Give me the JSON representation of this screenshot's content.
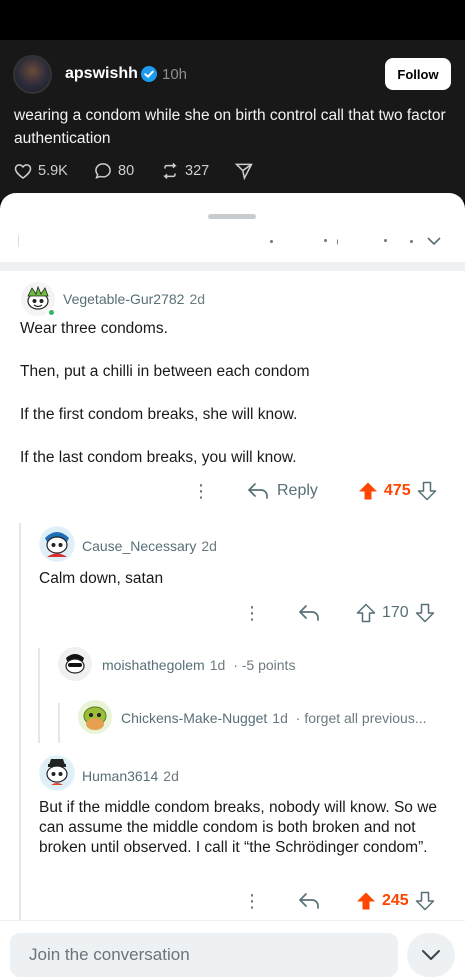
{
  "post": {
    "username": "apswishh",
    "time": "10h",
    "follow_label": "Follow",
    "text": "wearing a condom while she on birth control call that two factor authentication",
    "likes": "5.9K",
    "replies": "80",
    "reposts": "327"
  },
  "comments": [
    {
      "username": "Vegetable-Gur2782",
      "age": "2d",
      "paragraphs": [
        "Wear three condoms.",
        "Then, put a chilli in between each condom",
        "If the first condom breaks, she will know.",
        "If the last condom breaks, you will know."
      ],
      "reply_label": "Reply",
      "score": "475",
      "upvoted": true
    },
    {
      "username": "Cause_Necessary",
      "age": "2d",
      "text": "Calm down, satan",
      "score": "170",
      "upvoted": false
    },
    {
      "username": "moishathegolem",
      "age": "1d",
      "extra": "· -5 points"
    },
    {
      "username": "Chickens-Make-Nugget",
      "age": "1d",
      "extra": "· forget all previous..."
    },
    {
      "username": "Human3614",
      "age": "2d",
      "text": "But if the middle condom breaks, nobody will know. So we can assume the middle condom is both broken and not broken until observed. I call it “the Schrödinger condom”.",
      "score": "245",
      "upvoted": true
    }
  ],
  "composer": {
    "placeholder": "Join the conversation"
  },
  "colors": {
    "upvote": "#ff4500",
    "verified": "#1d9bf0",
    "muted": "#576f76"
  }
}
